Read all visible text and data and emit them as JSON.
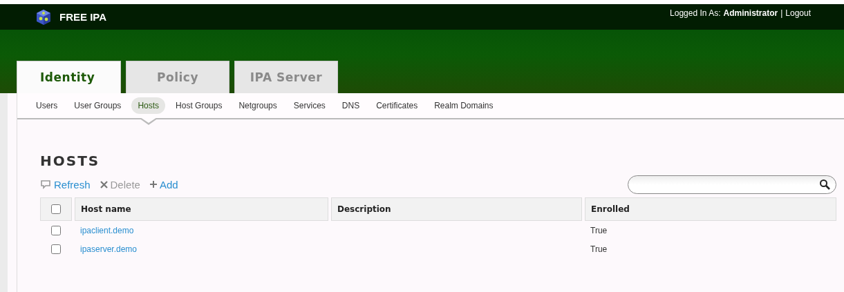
{
  "header": {
    "title": "FREE IPA",
    "login_label": "Logged In As:",
    "user": "Administrator",
    "separator": "|",
    "logout": "Logout"
  },
  "tabs": [
    {
      "label": "Identity",
      "selected": true
    },
    {
      "label": "Policy",
      "selected": false
    },
    {
      "label": "IPA Server",
      "selected": false
    }
  ],
  "subnav": [
    {
      "label": "Users",
      "selected": false
    },
    {
      "label": "User Groups",
      "selected": false
    },
    {
      "label": "Hosts",
      "selected": true
    },
    {
      "label": "Host Groups",
      "selected": false
    },
    {
      "label": "Netgroups",
      "selected": false
    },
    {
      "label": "Services",
      "selected": false
    },
    {
      "label": "DNS",
      "selected": false
    },
    {
      "label": "Certificates",
      "selected": false
    },
    {
      "label": "Realm Domains",
      "selected": false
    }
  ],
  "page_title": "HOSTS",
  "actions": [
    {
      "kind": "refresh",
      "label": "Refresh",
      "disabled": false
    },
    {
      "kind": "delete",
      "label": "Delete",
      "disabled": true
    },
    {
      "kind": "add",
      "label": "Add",
      "disabled": false
    }
  ],
  "table": {
    "select_all_checked": false,
    "columns": [
      "Host name",
      "Description",
      "Enrolled"
    ],
    "rows": [
      {
        "checked": false,
        "host": "ipaclient.demo",
        "description": "",
        "enrolled": "True"
      },
      {
        "checked": false,
        "host": "ipaserver.demo",
        "description": "",
        "enrolled": "True"
      }
    ]
  }
}
